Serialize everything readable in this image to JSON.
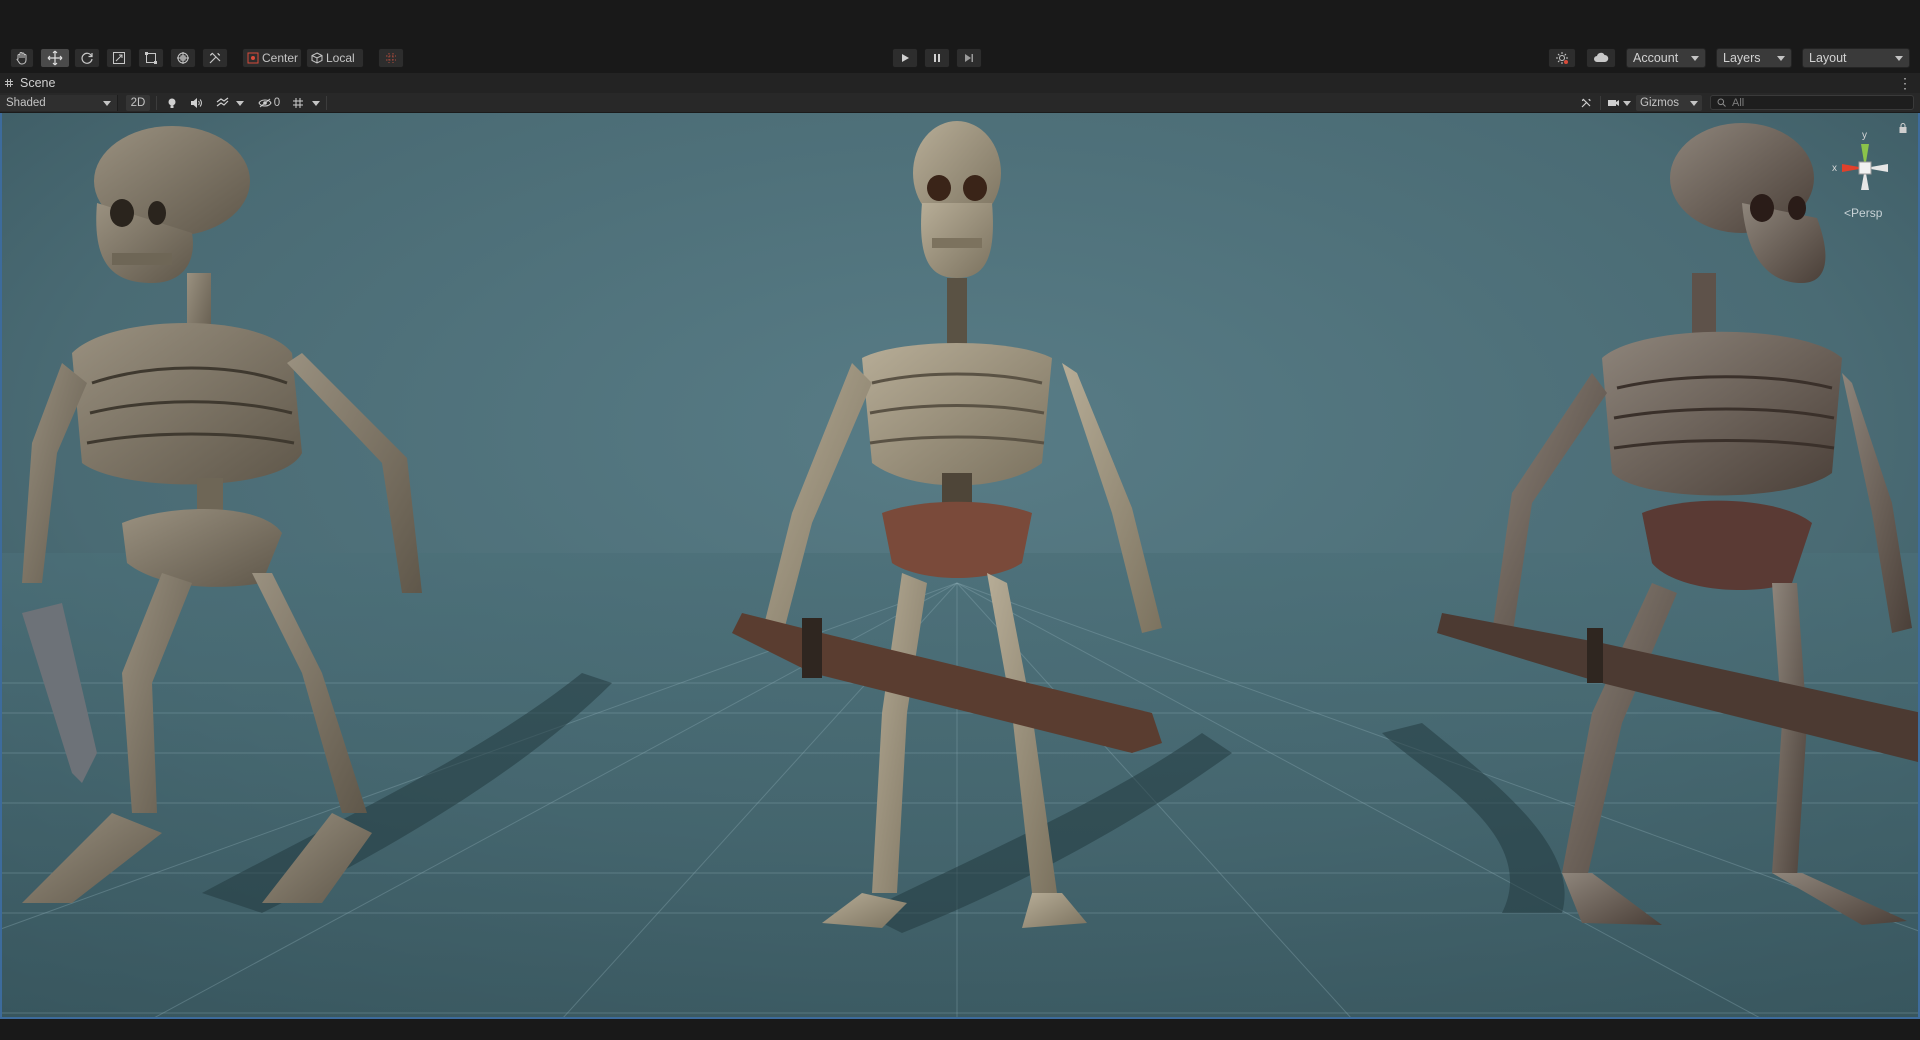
{
  "toolbar": {
    "tools": [
      "hand-tool",
      "move-tool",
      "rotate-tool",
      "scale-tool",
      "rect-tool",
      "transform-tool",
      "custom-tool"
    ],
    "pivot_label": "Center",
    "space_label": "Local",
    "play_controls": [
      "play",
      "pause",
      "step"
    ],
    "account_label": "Account",
    "layers_label": "Layers",
    "layout_label": "Layout"
  },
  "tab": {
    "label": "Scene"
  },
  "scene_toolbar": {
    "draw_mode": "Shaded",
    "toggle_2d": "2D",
    "hidden_count": "0",
    "gizmos_label": "Gizmos",
    "search_placeholder": "All"
  },
  "viewport": {
    "background_color": "#4a6b74",
    "grid_color": "#8fb0b8",
    "selection_border_color": "#3d6b9c",
    "objects": [
      "skeleton-left",
      "skeleton-center",
      "skeleton-right"
    ]
  },
  "orientation_gizmo": {
    "y_axis": "y",
    "x_axis": "x",
    "projection_label": "Persp",
    "colors": {
      "y": "#8bc34a",
      "x": "#e0402b",
      "z": "#e6e6e6"
    }
  }
}
